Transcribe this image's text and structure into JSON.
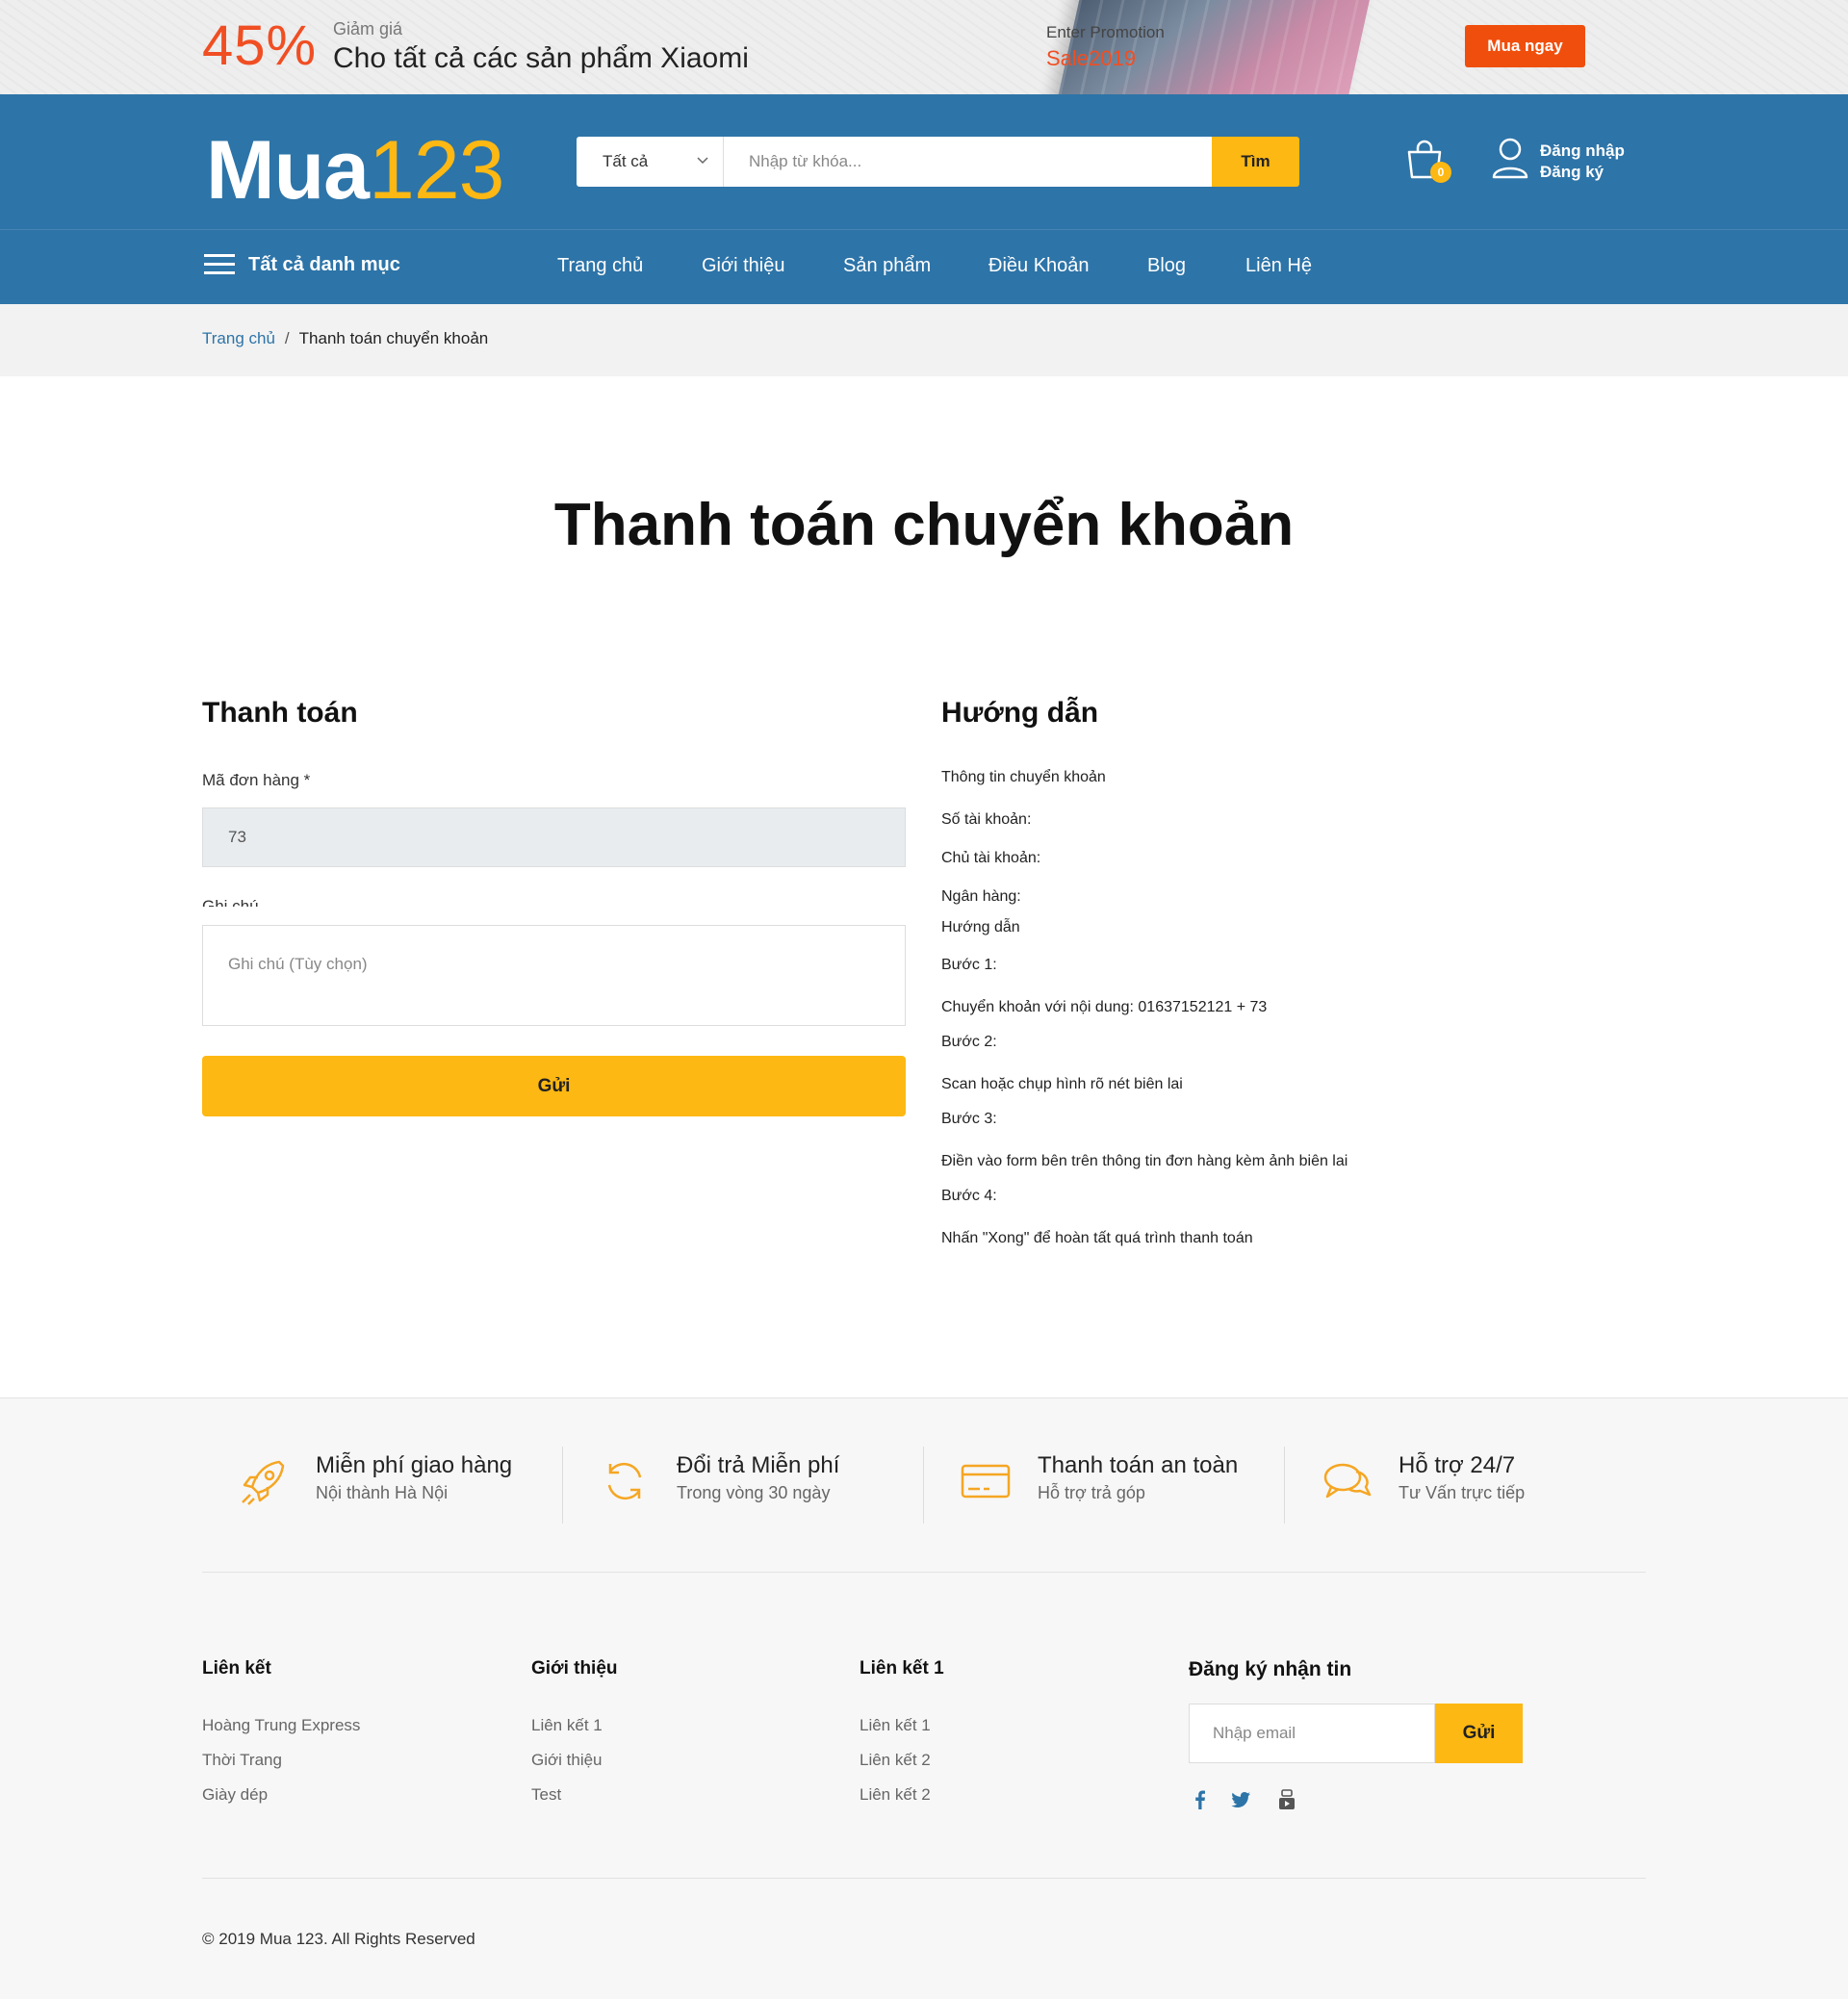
{
  "promo": {
    "percent": "45%",
    "small": "Giảm giá",
    "big": "Cho tất cả các sản phẩm Xiaomi",
    "enter": "Enter Promotion",
    "sale": "Sale2019",
    "buy_label": "Mua ngay"
  },
  "header": {
    "logo_word": "Mua",
    "logo_num": "123",
    "search_category": "Tất cả",
    "search_placeholder": "Nhập từ khóa...",
    "search_button": "Tìm",
    "cart_count": "0",
    "login": "Đăng nhập",
    "register": "Đăng ký"
  },
  "nav": {
    "all_categories": "Tất cả danh mục",
    "items": [
      "Trang chủ",
      "Giới thiệu",
      "Sản phẩm",
      "Điều Khoản",
      "Blog",
      "Liên Hệ"
    ]
  },
  "breadcrumb": {
    "home": "Trang chủ",
    "separator": "/",
    "current": "Thanh toán chuyển khoản"
  },
  "page": {
    "title": "Thanh toán chuyển khoản"
  },
  "payment_form": {
    "heading": "Thanh toán",
    "order_label": "Mã đơn hàng *",
    "order_value": "73",
    "note_label": "Ghi chú",
    "note_placeholder": "Ghi chú (Tùy chọn)",
    "submit": "Gửi"
  },
  "guide": {
    "heading": "Hướng dẫn",
    "transfer_info_title": "Thông tin chuyển khoản",
    "account_number": "Số tài khoản:",
    "account_holder": "Chủ tài khoản:",
    "bank": "Ngân hàng:",
    "steps_title": "Hướng dẫn",
    "steps": [
      {
        "title": "Bước 1:",
        "text": "Chuyển khoản với nội dung: 01637152121 + 73"
      },
      {
        "title": "Bước 2:",
        "text": "Scan hoặc chụp hình rõ nét biên lai"
      },
      {
        "title": "Bước 3:",
        "text": "Điền vào form bên trên thông tin đơn hàng kèm ảnh biên lai"
      },
      {
        "title": "Bước 4:",
        "text": "Nhấn \"Xong\" để hoàn tất quá trình thanh toán"
      }
    ]
  },
  "features": [
    {
      "icon": "rocket-icon",
      "title": "Miễn phí giao hàng",
      "sub": "Nội thành Hà Nội"
    },
    {
      "icon": "refresh-icon",
      "title": "Đổi trả Miễn phí",
      "sub": "Trong vòng 30 ngày"
    },
    {
      "icon": "credit-card-icon",
      "title": "Thanh toán an toàn",
      "sub": "Hỗ trợ trả góp"
    },
    {
      "icon": "chat-icon",
      "title": "Hỗ trợ 24/7",
      "sub": "Tư Vấn trực tiếp"
    }
  ],
  "footer": {
    "columns": [
      {
        "heading": "Liên kết",
        "items": [
          "Hoàng Trung Express",
          "Thời Trang",
          "Giày dép"
        ]
      },
      {
        "heading": "Giới thiệu",
        "items": [
          "Liên kết 1",
          "Giới thiệu",
          "Test"
        ]
      },
      {
        "heading": "Liên kết 1",
        "items": [
          "Liên kết 1",
          "Liên kết 2",
          "Liên kết 2"
        ]
      }
    ],
    "newsletter_heading": "Đăng ký nhận tin",
    "newsletter_placeholder": "Nhập email",
    "newsletter_button": "Gửi",
    "social": [
      "facebook-icon",
      "twitter-icon",
      "youtube-icon"
    ],
    "copyright": "© 2019 Mua 123. All Rights Reserved"
  },
  "colors": {
    "header_blue": "#2d74a8",
    "accent_yellow": "#fdb813",
    "promo_orange": "#f04e23"
  }
}
